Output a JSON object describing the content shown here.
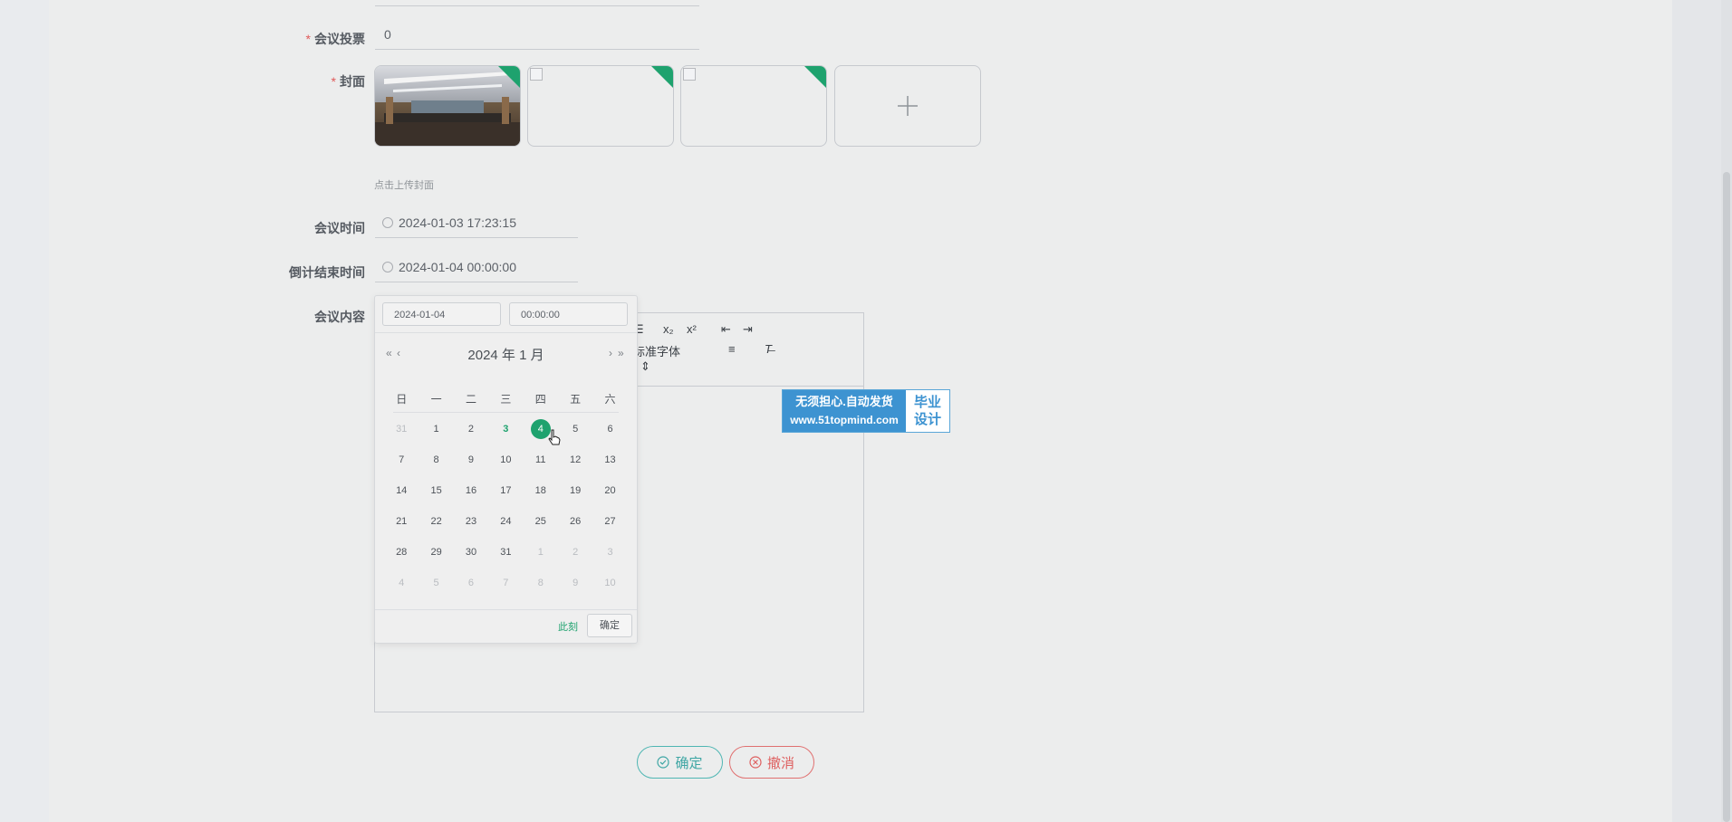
{
  "form": {
    "votes": {
      "label": "会议投票",
      "value": "0"
    },
    "cover": {
      "label": "封面",
      "hint": "点击上传封面"
    },
    "meeting_time": {
      "label": "会议时间",
      "value": "2024-01-03 17:23:15"
    },
    "countdown_end": {
      "label": "倒计结束时间",
      "value": "2024-01-04 00:00:00"
    },
    "content": {
      "label": "会议内容"
    }
  },
  "editor": {
    "subscript": "x₂",
    "superscript": "x²",
    "font_select": "标准字体"
  },
  "datepicker": {
    "date_input": "2024-01-04",
    "time_input": "00:00:00",
    "year_month": "2024 年  1 月",
    "weekdays": [
      "日",
      "一",
      "二",
      "三",
      "四",
      "五",
      "六"
    ],
    "weeks": [
      [
        "31",
        "1",
        "2",
        "3",
        "4",
        "5",
        "6"
      ],
      [
        "7",
        "8",
        "9",
        "10",
        "11",
        "12",
        "13"
      ],
      [
        "14",
        "15",
        "16",
        "17",
        "18",
        "19",
        "20"
      ],
      [
        "21",
        "22",
        "23",
        "24",
        "25",
        "26",
        "27"
      ],
      [
        "28",
        "29",
        "30",
        "31",
        "1",
        "2",
        "3"
      ],
      [
        "4",
        "5",
        "6",
        "7",
        "8",
        "9",
        "10"
      ]
    ],
    "now_label": "此刻",
    "confirm_label": "确定"
  },
  "watermark": {
    "line1": "无须担心.自动发货",
    "line2": "www.51topmind.com",
    "right1": "毕业",
    "right2": "设计"
  },
  "actions": {
    "confirm_label": "确定",
    "cancel_label": "撤消"
  },
  "colors": {
    "accent": "#1ea26e",
    "confirm": "#3ea6a4",
    "cancel": "#de5f5f"
  }
}
